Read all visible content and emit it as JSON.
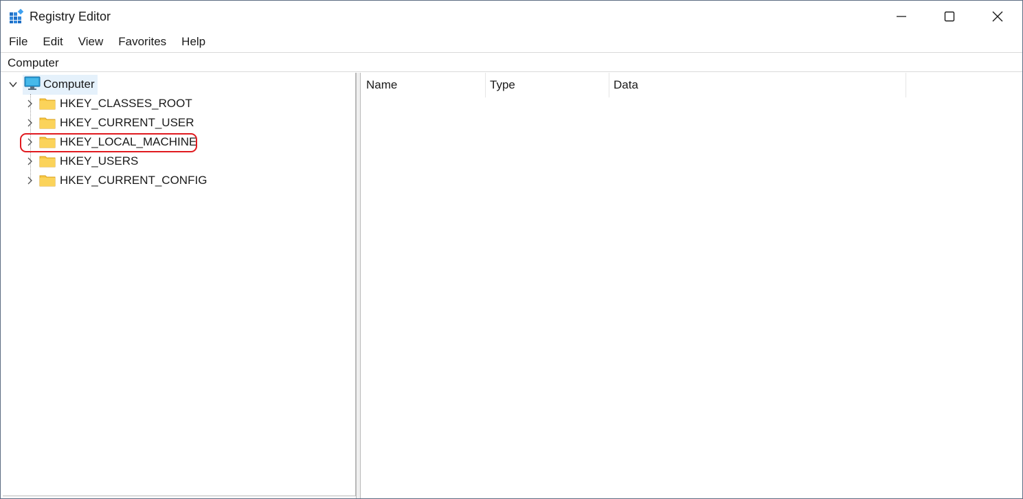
{
  "window": {
    "title": "Registry Editor",
    "icon": "registry-editor-icon",
    "controls": [
      "minimize-icon",
      "maximize-icon",
      "close-icon"
    ]
  },
  "menu": {
    "items": [
      {
        "label": "File"
      },
      {
        "label": "Edit"
      },
      {
        "label": "View"
      },
      {
        "label": "Favorites"
      },
      {
        "label": "Help"
      }
    ]
  },
  "address": {
    "path": "Computer"
  },
  "tree": {
    "root": {
      "label": "Computer",
      "icon": "monitor-icon",
      "expanded": true,
      "selected": true
    },
    "children": [
      {
        "label": "HKEY_CLASSES_ROOT",
        "icon": "folder-icon"
      },
      {
        "label": "HKEY_CURRENT_USER",
        "icon": "folder-icon"
      },
      {
        "label": "HKEY_LOCAL_MACHINE",
        "icon": "folder-icon",
        "highlighted": true
      },
      {
        "label": "HKEY_USERS",
        "icon": "folder-icon"
      },
      {
        "label": "HKEY_CURRENT_CONFIG",
        "icon": "folder-icon"
      }
    ]
  },
  "values": {
    "columns": [
      {
        "label": "Name"
      },
      {
        "label": "Type"
      },
      {
        "label": "Data"
      }
    ],
    "rows": []
  },
  "colors": {
    "highlight_ring": "#e0191e",
    "selection": "#e5f1fb",
    "folder": "#f8c843"
  }
}
